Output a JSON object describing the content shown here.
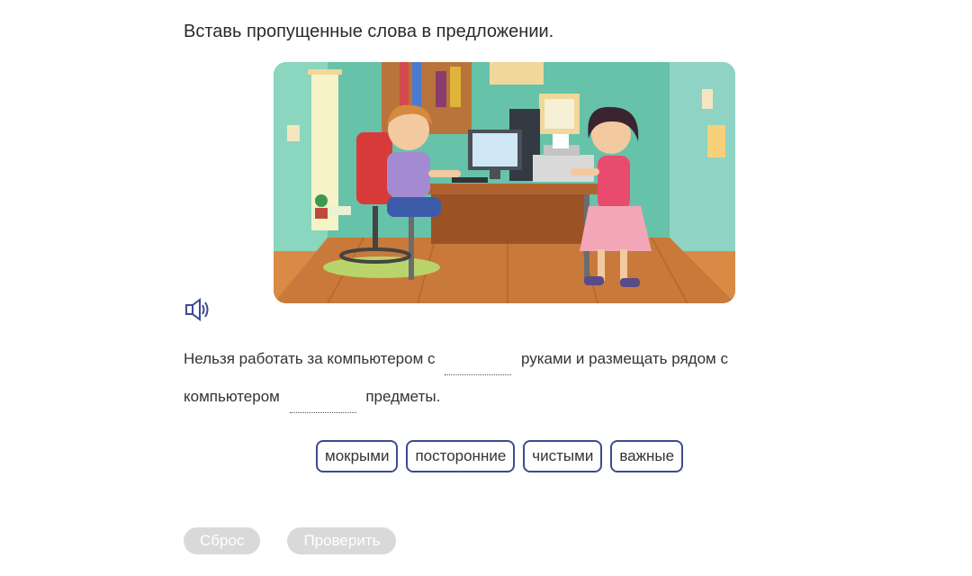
{
  "task": {
    "title": "Вставь пропущенные слова в предложении."
  },
  "illustration": {
    "description_icon": "children-computer-room-illustration"
  },
  "audio": {
    "icon": "speaker-icon"
  },
  "sentence": {
    "line1_part1": "Нельзя работать за компьютером с",
    "line1_part2": "руками и размещать рядом с",
    "line2_part1": "компьютером",
    "line2_part2": "предметы."
  },
  "options": [
    "мокрыми",
    "посторонние",
    "чистыми",
    "важные"
  ],
  "buttons": {
    "reset": "Сброс",
    "check": "Проверить"
  },
  "colors": {
    "chip_border": "#3d4b8f",
    "button_disabled": "#d9d9d9",
    "icon": "#3d4b8f"
  }
}
